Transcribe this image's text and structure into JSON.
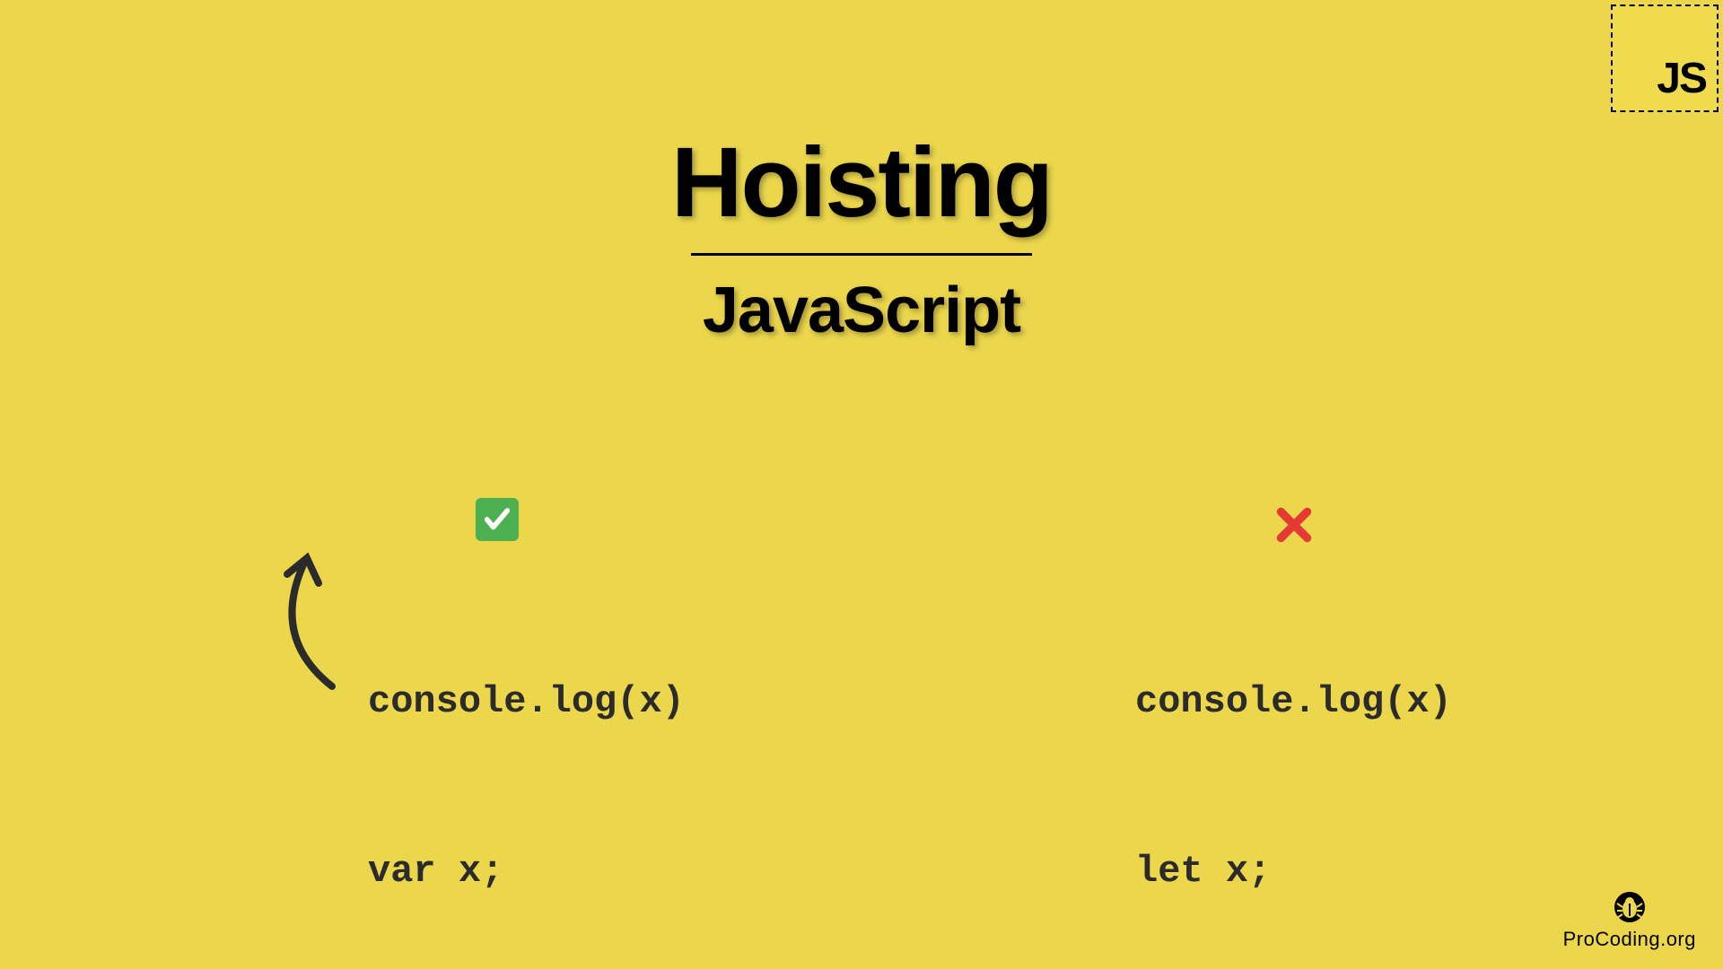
{
  "badge": {
    "text": "JS"
  },
  "header": {
    "title": "Hoisting",
    "subtitle": "JavaScript"
  },
  "examples": {
    "left": {
      "status": "valid",
      "code_line1": "console.log(x)",
      "code_line2": "var x;"
    },
    "right": {
      "status": "invalid",
      "code_line1": "console.log(x)",
      "code_line2": "let x;"
    }
  },
  "footer": {
    "brand": "ProCoding.org"
  },
  "colors": {
    "background": "#EBD64C",
    "js_yellow": "#F0DB4F",
    "text": "#000000",
    "success": "#4CAF50",
    "error": "#E53935",
    "code": "#2B2B2B"
  }
}
